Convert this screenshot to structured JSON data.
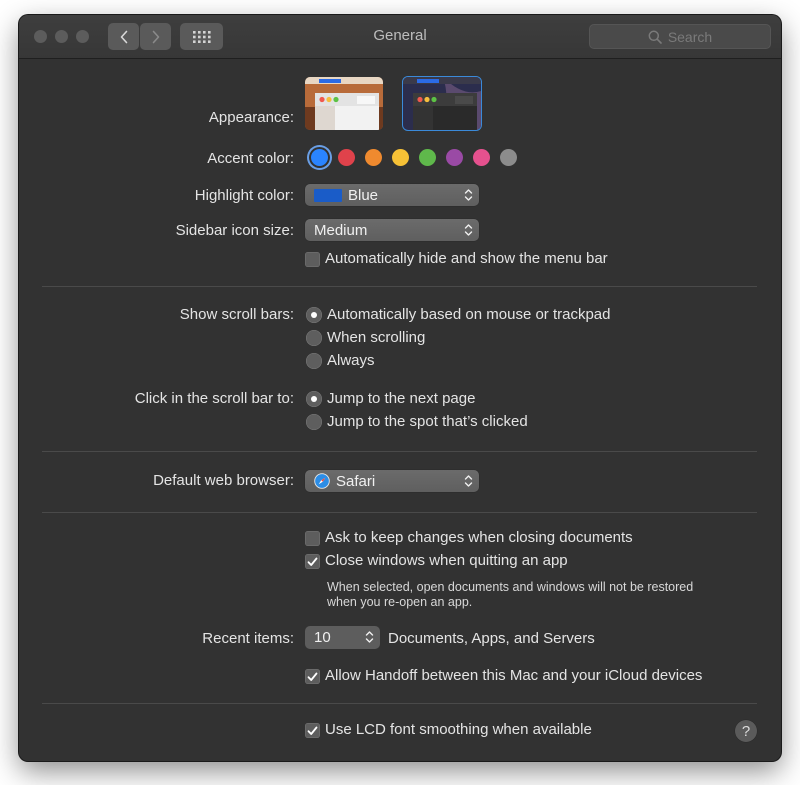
{
  "window": {
    "title": "General"
  },
  "toolbar": {
    "search_placeholder": "Search"
  },
  "appearance": {
    "label": "Appearance:",
    "selected": "dark"
  },
  "accent": {
    "label": "Accent color:",
    "colors": [
      "#2a84ff",
      "#e0424b",
      "#ef8a2f",
      "#f6c136",
      "#5fb84b",
      "#9a4aa5",
      "#e5518e",
      "#8c8c8c"
    ],
    "selected": "blue"
  },
  "highlight": {
    "label": "Highlight color:",
    "value": "Blue",
    "swatch": "#1a5cc8"
  },
  "sidebar_icon": {
    "label": "Sidebar icon size:",
    "value": "Medium"
  },
  "menubar": {
    "label": "Automatically hide and show the menu bar",
    "checked": false
  },
  "scroll_bars": {
    "label": "Show scroll bars:",
    "options": [
      "Automatically based on mouse or trackpad",
      "When scrolling",
      "Always"
    ],
    "selected": 0
  },
  "click_scroll": {
    "label": "Click in the scroll bar to:",
    "options": [
      "Jump to the next page",
      "Jump to the spot that’s clicked"
    ],
    "selected": 0
  },
  "browser": {
    "label": "Default web browser:",
    "value": "Safari"
  },
  "ask_changes": {
    "label": "Ask to keep changes when closing documents",
    "checked": false
  },
  "close_windows": {
    "label": "Close windows when quitting an app",
    "checked": true,
    "note_line1": "When selected, open documents and windows will not be restored",
    "note_line2": "when you re-open an app."
  },
  "recent": {
    "label": "Recent items:",
    "value": "10",
    "suffix": "Documents, Apps, and Servers"
  },
  "handoff": {
    "label": "Allow Handoff between this Mac and your iCloud devices",
    "checked": true
  },
  "lcd": {
    "label": "Use LCD font smoothing when available",
    "checked": true
  },
  "help": {
    "label": "?"
  }
}
